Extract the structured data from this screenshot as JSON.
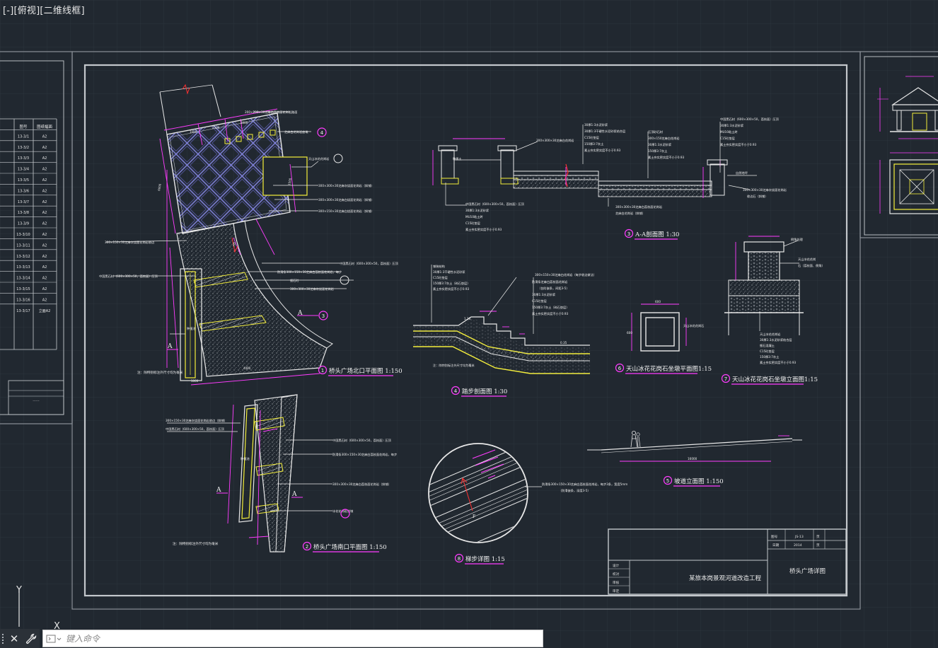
{
  "viewport": {
    "minus": "[-]",
    "view": "[俯视]",
    "style": "[二维线框]"
  },
  "command": {
    "placeholder": "键入命令",
    "close_icon": "close-icon",
    "tools_icon": "wrench-icon"
  },
  "ucs": {
    "y_label": "Y",
    "x_label": "X"
  },
  "titles": {
    "t1": "桥头广场北口平面图  1:150",
    "t2": "桥头广场南口平面图  1:150",
    "t3": "A-A剖面图  1:30",
    "t4": "踏步剖面图  1:30",
    "t5": "坡道立面图  1:150",
    "t6": "天山冰花花岗石坐墩平面图1:15",
    "t7": "天山冰花花岗石坐墩立面图1:15",
    "t8": "梯步详图  1:15"
  },
  "bubbles": [
    "1",
    "2",
    "3",
    "4",
    "5",
    "6",
    "7",
    "8"
  ],
  "section_marks": [
    "A",
    "A",
    "A",
    "A"
  ],
  "notes": {
    "n1": "注：除特别标注外尺寸均为毫米",
    "n2": "注：除特别标注外尺寸均为毫米",
    "n3": "注：除特别标注外尺寸均为毫米"
  },
  "titleblock": {
    "project": "某旅本岗景观河道改造工程",
    "drawing": "桥头广场详图",
    "no_label": "图号",
    "no_value": "JS-13"
  },
  "left_table": {
    "headers": [
      "图号",
      "图纸幅面"
    ],
    "codes": [
      "13-3/1",
      "13-3/2",
      "13-3/3",
      "13-3/4",
      "13-3/5",
      "13-3/6",
      "13-3/7",
      "13-3/8",
      "13-3/9",
      "13-3/10",
      "13-3/11",
      "13-3/12",
      "13-3/13",
      "13-3/14",
      "13-3/15",
      "13-3/16",
      "13-3/17"
    ],
    "sizes": [
      "A2",
      "A2",
      "A2",
      "A2",
      "A2",
      "A2",
      "A2",
      "A2",
      "A2",
      "A2",
      "A2",
      "A2",
      "A2",
      "A2",
      "A2",
      "A2",
      "立面A2"
    ]
  },
  "colors": {
    "bg": "#212830",
    "grid": "#2c333b",
    "white": "#f2f2f2",
    "magenta": "#ff3cff",
    "yellow": "#f4ee3a",
    "cyan": "#5fe0e6"
  }
}
